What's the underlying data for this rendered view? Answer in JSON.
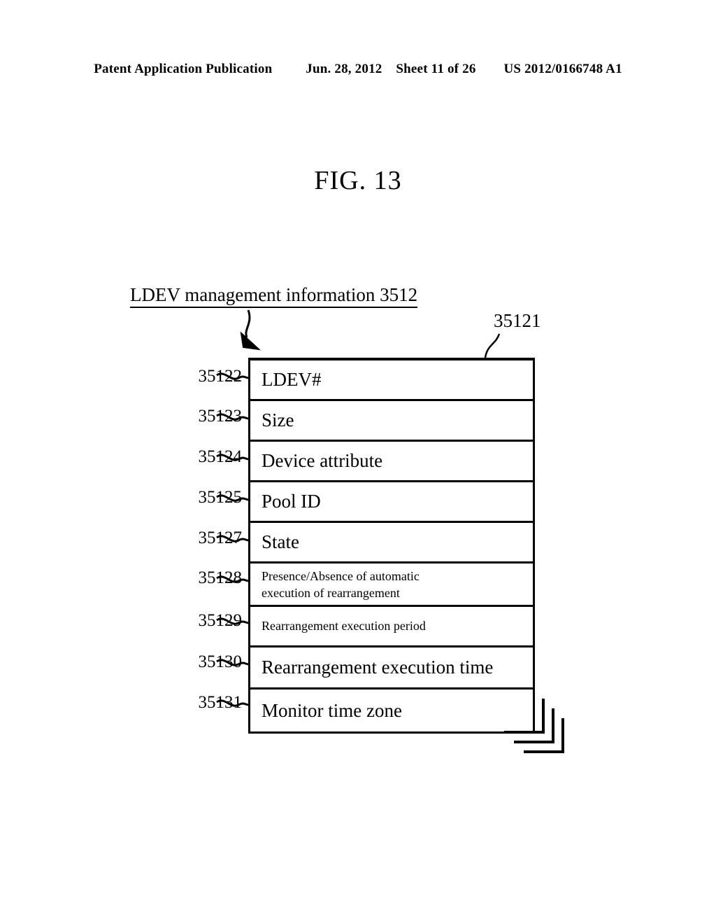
{
  "header": {
    "publication": "Patent Application Publication",
    "date": "Jun. 28, 2012",
    "sheet": "Sheet 11 of 26",
    "patent_number": "US 2012/0166748 A1"
  },
  "figure": {
    "title": "FIG. 13",
    "structure_heading": "LDEV management information 3512",
    "table_ref": "35121"
  },
  "table": {
    "rows": [
      {
        "ref": "35122",
        "label": "LDEV#",
        "size": "big"
      },
      {
        "ref": "35123",
        "label": "Size",
        "size": "big"
      },
      {
        "ref": "35124",
        "label": "Device attribute",
        "size": "big"
      },
      {
        "ref": "35125",
        "label": "Pool ID",
        "size": "big"
      },
      {
        "ref": "35127",
        "label": "State",
        "size": "big"
      },
      {
        "ref": "35128",
        "label_line1": "Presence/Absence of automatic",
        "label_line2": "execution of rearrangement",
        "size": "small"
      },
      {
        "ref": "35129",
        "label": "Rearrangement execution period",
        "size": "small"
      },
      {
        "ref": "35130",
        "label": "Rearrangement execution time",
        "size": "big"
      },
      {
        "ref": "35131",
        "label": "Monitor time zone",
        "size": "big"
      }
    ]
  },
  "colors": {
    "ink": "#000000",
    "paper": "#ffffff"
  }
}
